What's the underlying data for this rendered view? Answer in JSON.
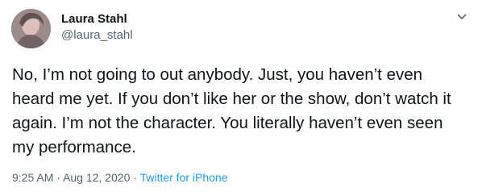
{
  "tweet": {
    "author": {
      "display_name": "Laura Stahl",
      "handle": "@laura_stahl",
      "avatar_icon": "avatar"
    },
    "menu_icon": "chevron-down-icon",
    "text": "No, I’m not going to out anybody. Just, you haven’t even heard me yet. If you don’t like her or the show, don’t watch it again. I’m not the character. You literally haven’t even seen my performance.",
    "time": "9:25 AM",
    "separator": "·",
    "date": "Aug 12, 2020",
    "source": "Twitter for iPhone"
  },
  "colors": {
    "text": "#0f1419",
    "muted": "#536471",
    "link": "#1d9bf0"
  }
}
